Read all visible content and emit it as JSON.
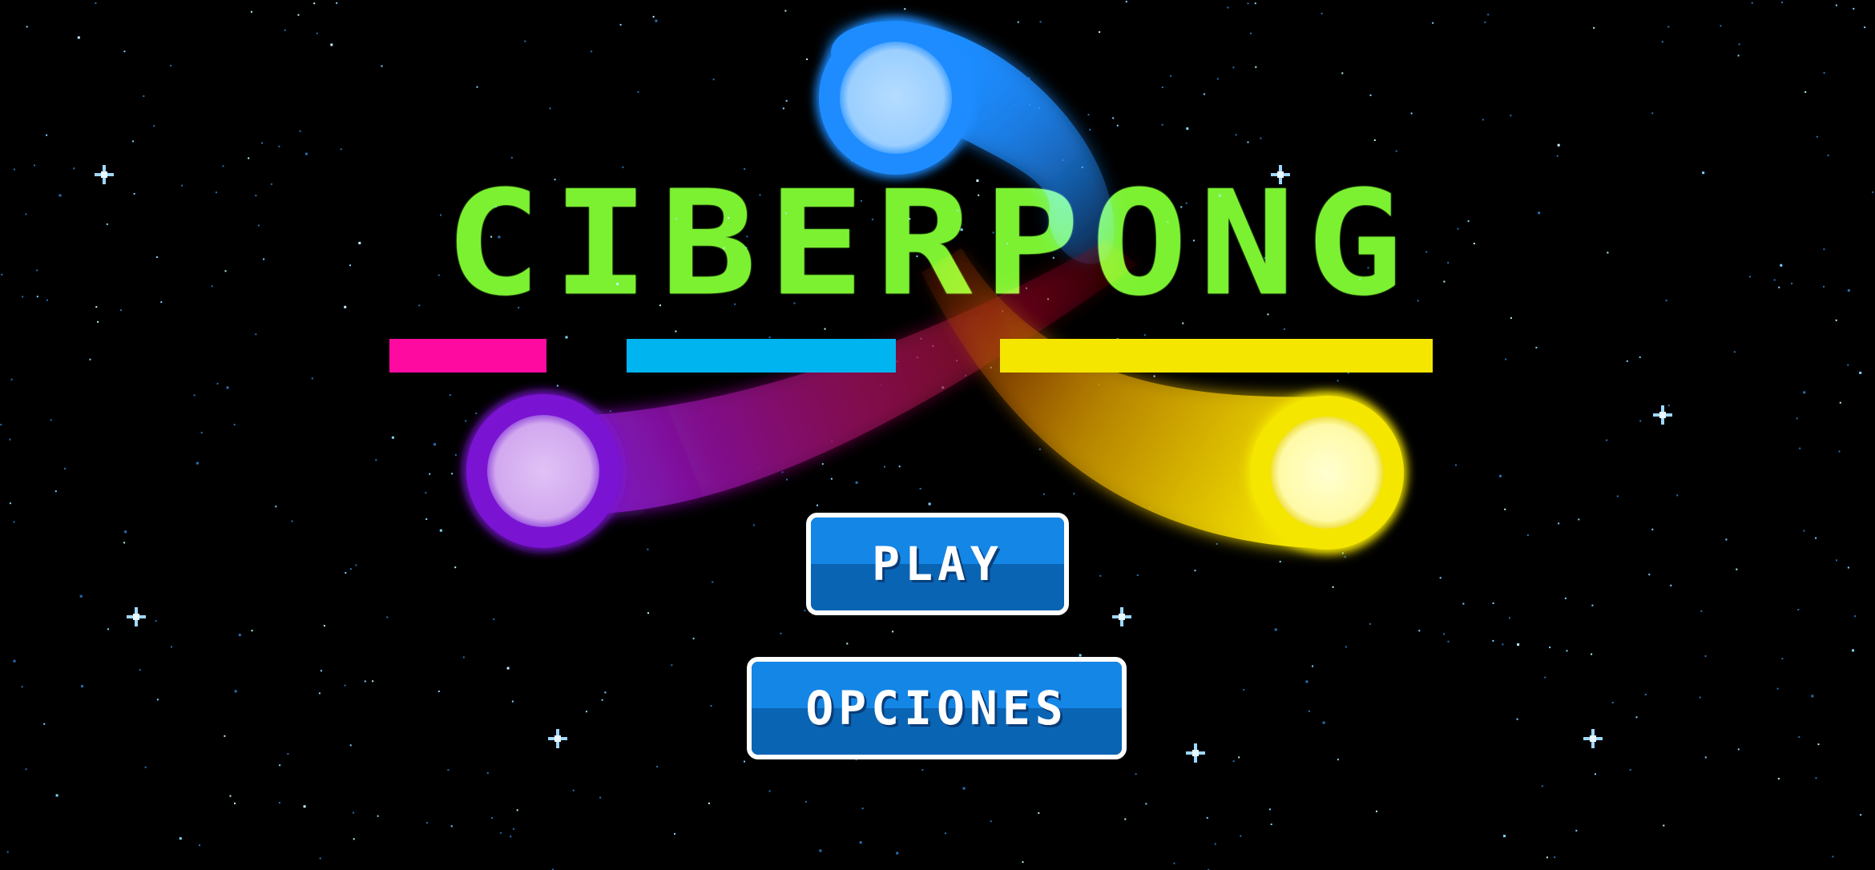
{
  "game": {
    "title": "CIBERPONG",
    "colors": {
      "title": "#7cf132",
      "bar_pink": "#ff0aa0",
      "bar_blue": "#00b4f0",
      "bar_yellow": "#f5e600",
      "ball_blue": "#1e8cff",
      "ball_purple": "#7a14d2",
      "ball_yellow": "#f5e600",
      "button_top": "#1486e6",
      "button_bottom": "#0a64b4",
      "button_border": "#ffffff",
      "star": "#7fd4ff"
    }
  },
  "menu": {
    "play_label": "PLAY",
    "options_label": "OPCIONES"
  }
}
